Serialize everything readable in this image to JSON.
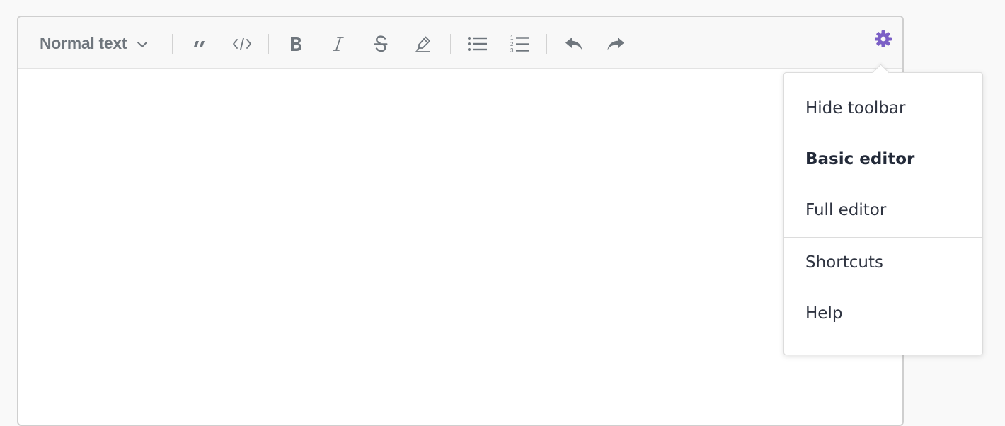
{
  "toolbar": {
    "text_style": {
      "label": "Normal text",
      "icon": "chevron-down-icon"
    },
    "buttons": [
      {
        "name": "blockquote",
        "icon": "quote-icon"
      },
      {
        "name": "code",
        "icon": "code-icon"
      },
      {
        "name": "bold",
        "icon": "bold-icon"
      },
      {
        "name": "italic",
        "icon": "italic-icon"
      },
      {
        "name": "strikethrough",
        "icon": "strikethrough-icon"
      },
      {
        "name": "highlight",
        "icon": "highlighter-icon"
      },
      {
        "name": "bullet-list",
        "icon": "bullet-list-icon"
      },
      {
        "name": "numbered-list",
        "icon": "numbered-list-icon"
      },
      {
        "name": "undo",
        "icon": "undo-icon"
      },
      {
        "name": "redo",
        "icon": "redo-icon"
      }
    ],
    "settings": {
      "icon": "gear-icon",
      "color": "#7b5fc6"
    },
    "icon_color": "#6f767d"
  },
  "settings_menu": {
    "items": [
      {
        "label": "Hide toolbar",
        "active": false
      },
      {
        "label": "Basic editor",
        "active": true
      },
      {
        "label": "Full editor",
        "active": false
      },
      {
        "label": "Shortcuts",
        "active": false
      },
      {
        "label": "Help",
        "active": false
      }
    ]
  }
}
